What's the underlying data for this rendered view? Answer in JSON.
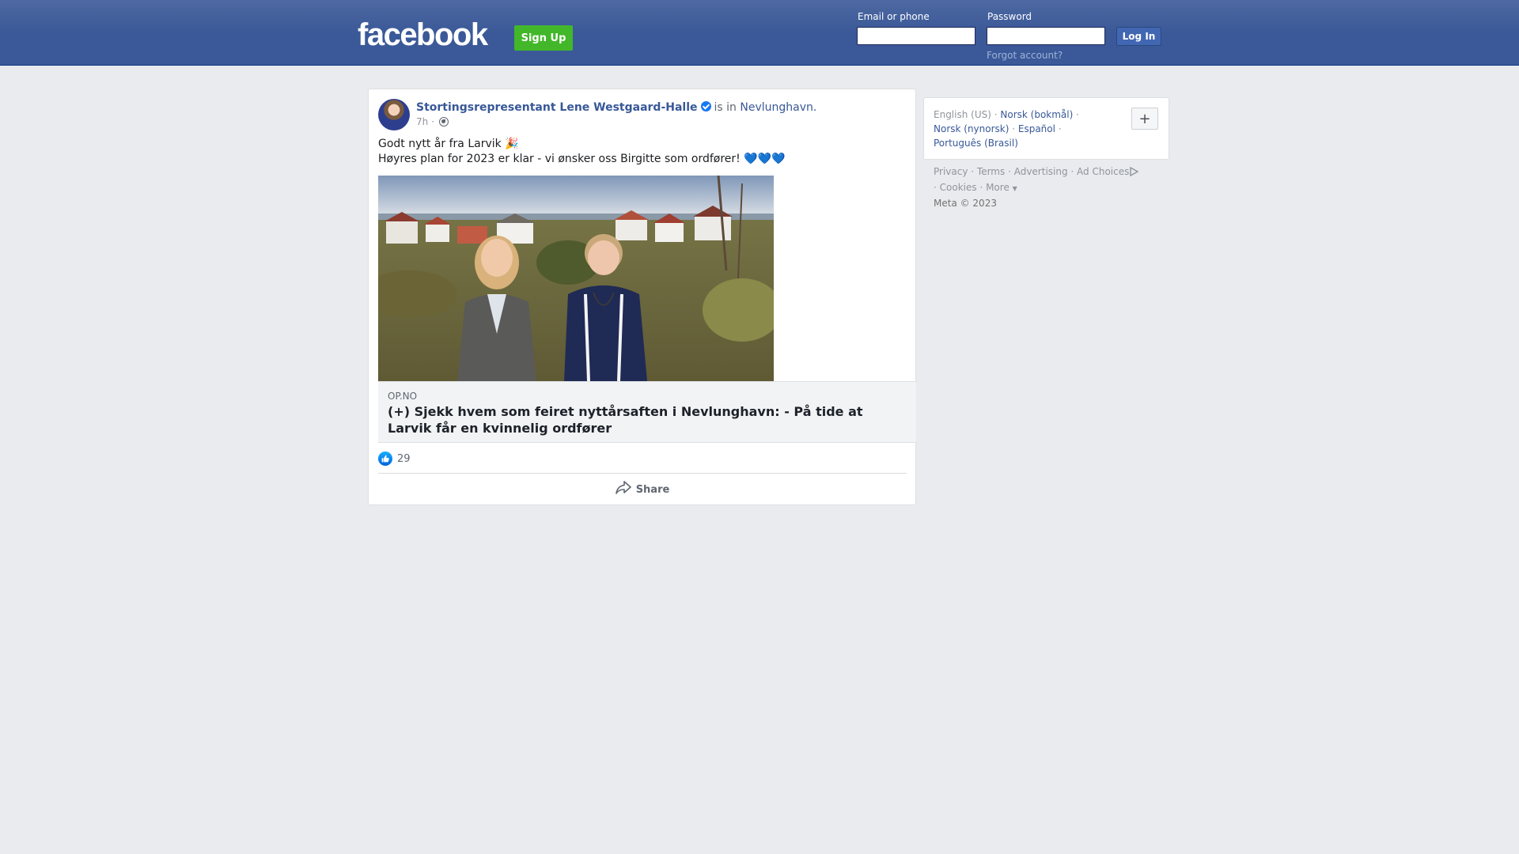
{
  "header": {
    "logo": "facebook",
    "signup_label": "Sign Up",
    "email_label": "Email or phone",
    "email_value": "",
    "password_label": "Password",
    "password_value": "",
    "login_label": "Log In",
    "forgot_label": "Forgot account?",
    "background_color": "#3b5998",
    "signup_color": "#42b72a"
  },
  "post": {
    "author": "Stortingsrepresentant Lene Westgaard-Halle",
    "verified_icon": "verified-badge-icon",
    "is_in": "is in",
    "place": "Nevlunghavn.",
    "time": "7h",
    "separator": "·",
    "privacy_icon": "globe-icon",
    "text_line1": "Godt nytt år fra Larvik 🎉",
    "text_line2": "Høyres plan for 2023 er klar - vi ønsker oss Birgitte som ordfører! 💙💙💙",
    "link_domain": "OP.NO",
    "link_title": "(+) Sjekk hvem som feiret nyttårsaften i Nevlunghavn: - På tide at Larvik får en kvinnelig ordfører",
    "reaction_icon": "like-icon",
    "reaction_count": "29",
    "share_label": "Share",
    "share_icon": "share-arrow-icon"
  },
  "sidebar": {
    "languages": [
      {
        "label": "English (US)",
        "current": true
      },
      {
        "label": "Norsk (bokmål)"
      },
      {
        "label": "Norsk (nynorsk)"
      },
      {
        "label": "Español"
      },
      {
        "label": "Português (Brasil)"
      }
    ],
    "add_language_label": "+",
    "footer": {
      "privacy": "Privacy",
      "terms": "Terms",
      "advertising": "Advertising",
      "ad_choices": "Ad Choices",
      "cookies": "Cookies",
      "more": "More",
      "copyright": "Meta © 2023"
    }
  }
}
